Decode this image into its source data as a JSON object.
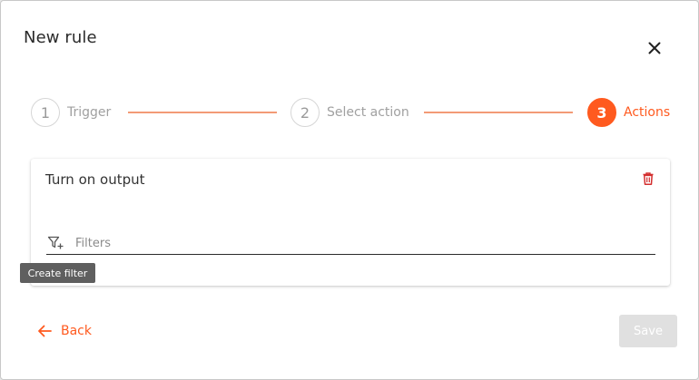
{
  "dialog": {
    "title": "New rule",
    "close_icon": "close-icon"
  },
  "stepper": {
    "steps": [
      {
        "number": "1",
        "label": "Trigger",
        "state": "inactive"
      },
      {
        "number": "2",
        "label": "Select action",
        "state": "inactive"
      },
      {
        "number": "3",
        "label": "Actions",
        "state": "active"
      }
    ]
  },
  "action_card": {
    "title": "Turn on output",
    "delete_icon": "trash-icon",
    "filter_icon": "filter-add-icon",
    "filter_placeholder": "Filters"
  },
  "tooltip": {
    "text": "Create filter"
  },
  "footer": {
    "back_label": "Back",
    "back_icon": "arrow-left-icon",
    "save_label": "Save"
  },
  "colors": {
    "accent": "#ff5a1f",
    "connector": "#f39a76",
    "delete": "#d32f2f",
    "disabled_button": "#e0e0e0",
    "tooltip_bg": "#5f5f5f"
  }
}
